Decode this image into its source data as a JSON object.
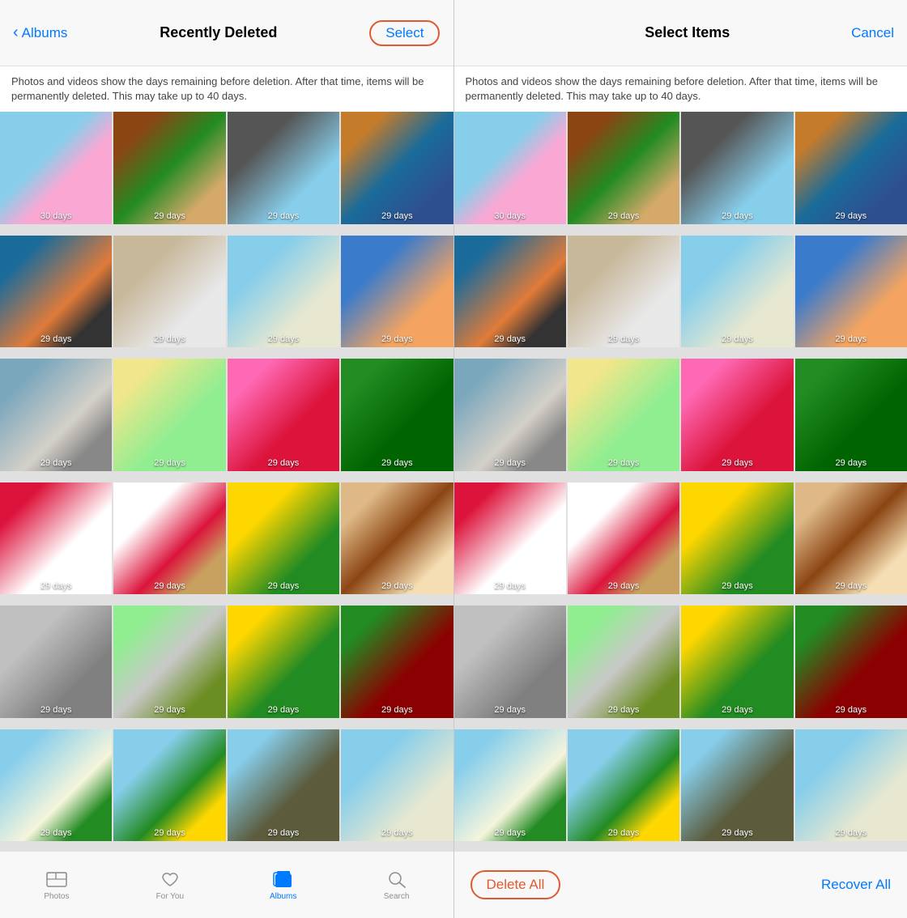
{
  "left": {
    "header": {
      "back_label": "Albums",
      "title": "Recently Deleted",
      "select_label": "Select"
    },
    "description": "Photos and videos show the days remaining before deletion. After that time, items will be permanently deleted. This may take up to 40 days.",
    "grid": {
      "rows": [
        [
          "30 days",
          "29 days",
          "29 days",
          "29 days"
        ],
        [
          "29 days",
          "29 days",
          "29 days",
          "29 days"
        ],
        [
          "29 days",
          "29 days",
          "29 days",
          "29 days"
        ],
        [
          "29 days",
          "29 days",
          "29 days",
          "29 days"
        ],
        [
          "29 days",
          "29 days",
          "29 days",
          "29 days"
        ],
        [
          "29 days",
          "29 days",
          "29 days",
          "29 days"
        ]
      ]
    },
    "tab_bar": {
      "items": [
        {
          "label": "Photos",
          "icon": "photos"
        },
        {
          "label": "For You",
          "icon": "heart"
        },
        {
          "label": "Albums",
          "icon": "albums",
          "active": true
        },
        {
          "label": "Search",
          "icon": "search"
        }
      ]
    }
  },
  "right": {
    "header": {
      "title": "Select Items",
      "cancel_label": "Cancel"
    },
    "description": "Photos and videos show the days remaining before deletion. After that time, items will be permanently deleted. This may take up to 40 days.",
    "grid": {
      "rows": [
        [
          "30 days",
          "29 days",
          "29 days",
          "29 days"
        ],
        [
          "29 days",
          "29 days",
          "29 days",
          "29 days"
        ],
        [
          "29 days",
          "29 days",
          "29 days",
          "29 days"
        ],
        [
          "29 days",
          "29 days",
          "29 days",
          "29 days"
        ],
        [
          "29 days",
          "29 days",
          "29 days",
          "29 days"
        ],
        [
          "29 days",
          "29 days",
          "29 days",
          "29 days"
        ]
      ]
    },
    "action_bar": {
      "delete_all_label": "Delete All",
      "recover_all_label": "Recover All"
    }
  }
}
